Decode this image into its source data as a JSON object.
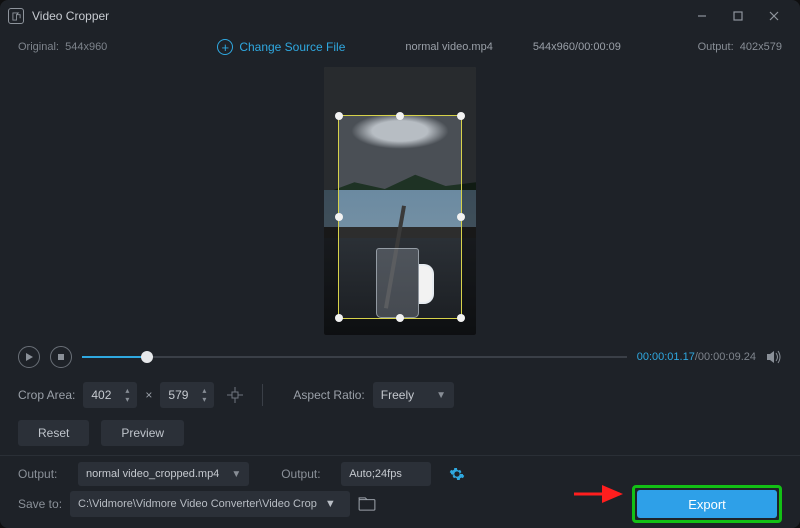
{
  "title": "Video Cropper",
  "info": {
    "original_label": "Original:",
    "original_dims": "544x960",
    "change_source": "Change Source File",
    "filename": "normal video.mp4",
    "source_meta": "544x960/00:00:09",
    "output_label": "Output:",
    "output_dims": "402x579"
  },
  "playback": {
    "current": "00:00:01.17",
    "total": "/00:00:09.24"
  },
  "crop": {
    "area_label": "Crop Area:",
    "width": "402",
    "sep": "×",
    "height": "579",
    "aspect_label": "Aspect Ratio:",
    "aspect_value": "Freely"
  },
  "buttons": {
    "reset": "Reset",
    "preview": "Preview",
    "export": "Export"
  },
  "output": {
    "label1": "Output:",
    "filename": "normal video_cropped.mp4",
    "label2": "Output:",
    "preset": "Auto;24fps"
  },
  "save": {
    "label": "Save to:",
    "path": "C:\\Vidmore\\Vidmore Video Converter\\Video Crop"
  }
}
